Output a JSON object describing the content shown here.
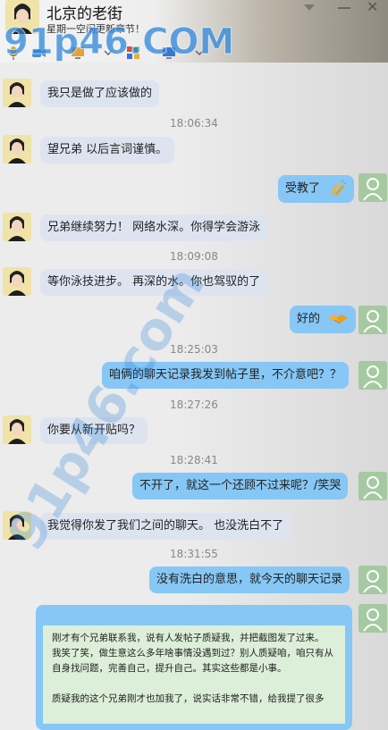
{
  "header": {
    "title": "北京的老街",
    "subtitle": "星期一空闲更新章节！"
  },
  "watermark": {
    "top": "91p46.COM",
    "diagonal": "91p46.com"
  },
  "messages": [
    {
      "side": "left",
      "text": "我只是做了应该做的"
    },
    {
      "side": "ts",
      "text": "18:06:34"
    },
    {
      "side": "left",
      "text": "望兄弟 以后言词谨慎。"
    },
    {
      "side": "right",
      "text": "受教了",
      "emoji": "clap-icon"
    },
    {
      "side": "left",
      "text": "兄弟继续努力！ 网络水深。你得学会游泳"
    },
    {
      "side": "ts",
      "text": "18:09:08"
    },
    {
      "side": "left",
      "text": "等你泳技进步。 再深的水。你也驾驭的了"
    },
    {
      "side": "right",
      "text": "好的",
      "emoji": "handshake-icon"
    },
    {
      "side": "ts",
      "text": "18:25:03"
    },
    {
      "side": "right",
      "text": "咱俩的聊天记录我发到帖子里，不介意吧？？"
    },
    {
      "side": "ts",
      "text": "18:27:26"
    },
    {
      "side": "left",
      "text": "你要从新开贴吗？"
    },
    {
      "side": "ts",
      "text": "18:28:41"
    },
    {
      "side": "right",
      "text": "不开了，就这一个还顾不过来呢？/笑哭"
    },
    {
      "side": "left",
      "text": "我觉得你发了我们之间的聊天。 也没洗白不了"
    },
    {
      "side": "ts",
      "text": "18:31:55"
    },
    {
      "side": "right",
      "text": "没有洗白的意思，就今天的聊天记录"
    }
  ],
  "letter": {
    "lines": [
      "刚才有个兄弟联系我，说有人发帖子质疑我，并把截图发了过来。",
      "我笑了笑，做生意这么多年啥事情没遇到过？别人质疑咱，咱只有从",
      "自身找问题，完善自己，提升自己。其实这些都是小事。",
      "",
      "质疑我的这个兄弟刚才也加我了，说实话非常不错，给我提了很多"
    ]
  },
  "colors": {
    "left_bubble": "#dde4f0",
    "right_bubble": "#86c7f5",
    "letter_bg": "#dcefd8",
    "watermark": "#2e86d9"
  }
}
